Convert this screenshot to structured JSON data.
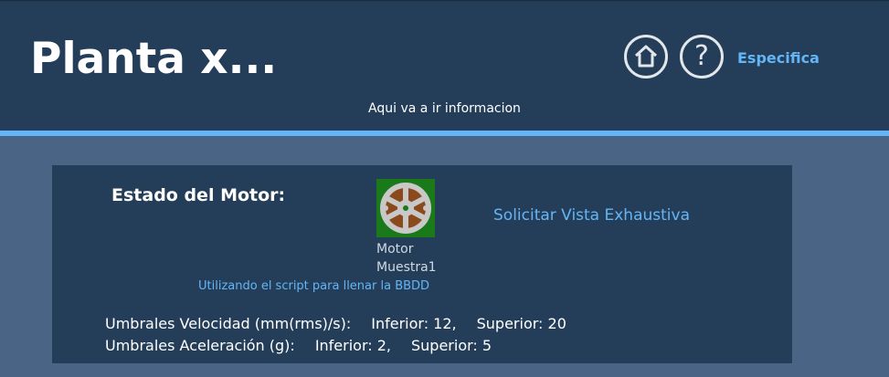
{
  "header": {
    "title": "Planta x...",
    "subtitle": "Aqui va a ir informacion",
    "home_icon": "home-icon",
    "help_icon": "help-icon",
    "help_glyph": "?",
    "especifica_label": "Especifica"
  },
  "colors": {
    "header_bg": "#243e59",
    "page_bg": "#4a6486",
    "accent": "#64b5f6",
    "motor_icon_bg": "#1a7a1a"
  },
  "card": {
    "estado_label": "Estado del Motor:",
    "motor_icon": "motor-wheel-icon",
    "motor_name_line1": "Motor",
    "motor_name_line2": "Muestra1",
    "solicitar_label": "Solicitar Vista Exhaustiva",
    "script_link": "Utilizando el script para llenar la BBDD",
    "thresholds": [
      {
        "label": "Umbrales Velocidad (mm(rms)/s):",
        "inferior": "Inferior: 12,",
        "superior": "Superior: 20"
      },
      {
        "label": "Umbrales Aceleración (g):",
        "inferior": "Inferior: 2,",
        "superior": "Superior: 5"
      }
    ]
  }
}
